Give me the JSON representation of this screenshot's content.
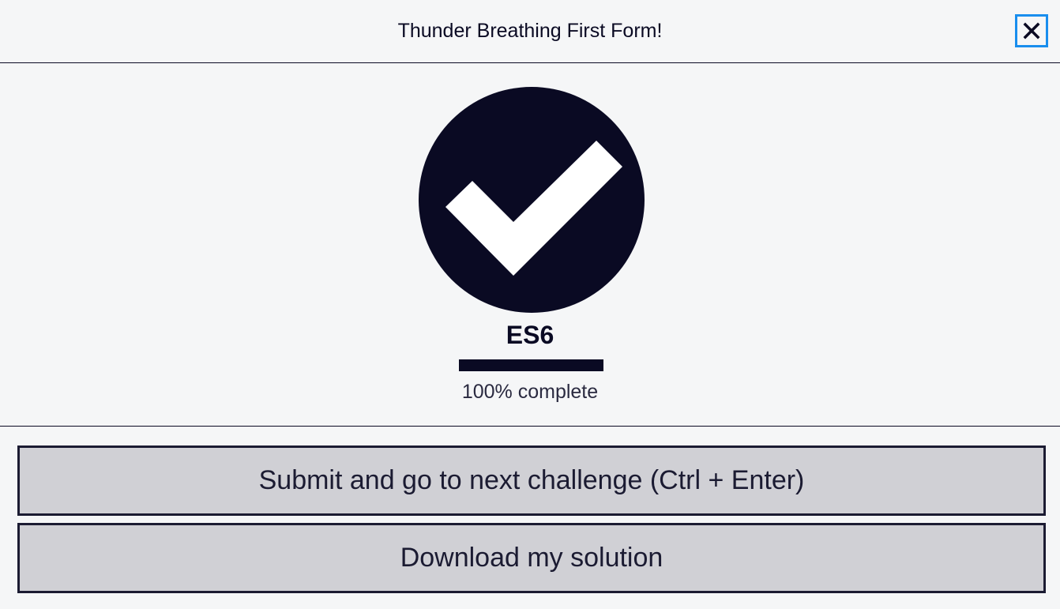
{
  "modal": {
    "title": "Thunder Breathing First Form!",
    "close_icon": "close-icon"
  },
  "completion": {
    "icon": "checkmark-circle-icon",
    "certification": "ES6",
    "progress_percent": 100,
    "progress_text": "100% complete"
  },
  "actions": {
    "submit_label": "Submit and go to next challenge (Ctrl + Enter)",
    "download_label": "Download my solution"
  },
  "colors": {
    "background": "#f5f6f7",
    "primary_dark": "#0a0a23",
    "button_bg": "#d0d0d5",
    "focus_outline": "#198eee"
  }
}
